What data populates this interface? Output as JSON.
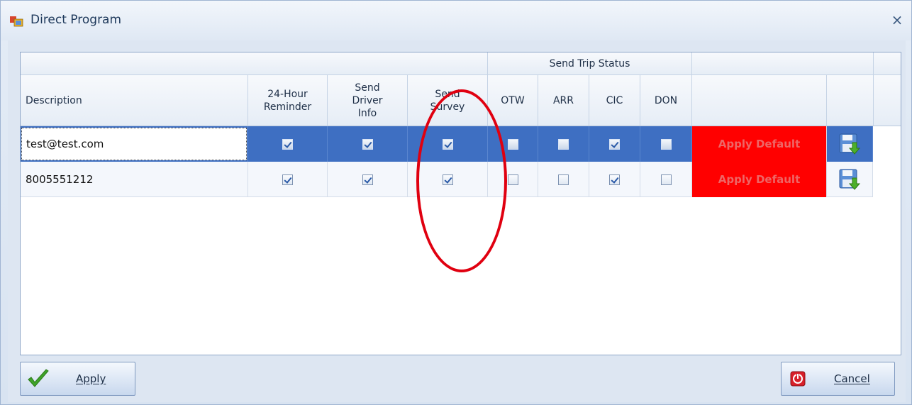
{
  "window": {
    "title": "Direct Program",
    "close_glyph": "×"
  },
  "grid": {
    "group_header": "Send Trip Status",
    "columns": {
      "description": "Description",
      "reminder": "24-Hour Reminder",
      "driver_info": "Send Driver Info",
      "survey": "Send Survey",
      "otw": "OTW",
      "arr": "ARR",
      "cic": "CIC",
      "don": "DON"
    },
    "rows": [
      {
        "description": "test@test.com",
        "reminder": true,
        "driver_info": true,
        "survey": true,
        "otw": false,
        "arr": false,
        "cic": true,
        "don": false,
        "action": "Apply Default",
        "selected": true
      },
      {
        "description": "8005551212",
        "reminder": true,
        "driver_info": true,
        "survey": true,
        "otw": false,
        "arr": false,
        "cic": true,
        "don": false,
        "action": "Apply Default",
        "selected": false
      }
    ]
  },
  "buttons": {
    "apply": "Apply",
    "cancel": "Cancel"
  },
  "icons": {
    "title": "app-window-icon",
    "apply": "green-check-icon",
    "cancel": "red-stop-icon",
    "row_save": "save-disk-icon"
  },
  "colors": {
    "selected_row": "#3e6fc2",
    "apply_default_bg": "#ff0000",
    "annotation": "#e00010"
  }
}
